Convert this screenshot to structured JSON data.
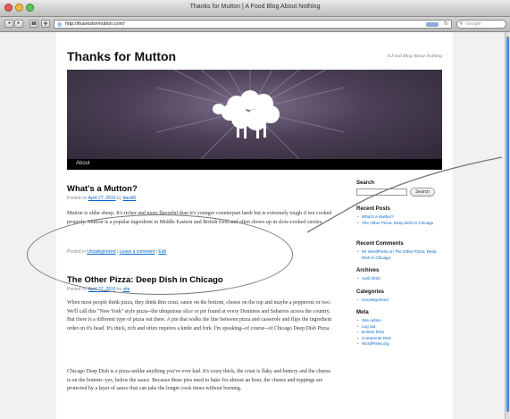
{
  "window": {
    "title": "Thanks for Mutton | A Food Blog About Nothing"
  },
  "toolbar": {
    "back_label": "◂",
    "forward_label": "▸",
    "address": "http://thanksformutton.com/",
    "address_icon": "globe-icon",
    "search_placeholder": "Google"
  },
  "blog": {
    "title": "Thanks for Mutton",
    "description": "A Food Blog About Nothing",
    "nav": [
      "About"
    ]
  },
  "posts": [
    {
      "title": "What's a Mutton?",
      "meta_prefix": "Posted on",
      "date": "April 27, 2010",
      "meta_by": "by",
      "author": "david5",
      "paragraphs": [
        "Mutton is older sheep. It's richer and more flavorful than it's younger counterpart lamb but is extremely tough if not cooked properly. Mutton is a popular ingredient in Middle Eastern and British food and often shows up in slow-cooked curries."
      ],
      "util_prefix": "Posted in",
      "category": "Uncategorized",
      "comment_link": "Leave a comment",
      "edit_link": "Edit"
    },
    {
      "title": "The Other Pizza: Deep Dish in Chicago",
      "meta_prefix": "Posted on",
      "date": "April 27, 2010",
      "meta_by": "by",
      "author": "site",
      "paragraphs": [
        "When most people think pizza, they think thin crust, sauce on the bottom, cheese on the top and maybe a pepperoni or two. We'll call this \"New York\" style pizza--the ubiquitous slice or pie found at every Dominos and Sabarros across the country. But there is a different type of pizza out there. A pie that walks the line between pizza and casserole and flips the ingredient order on it's head. It's thick, rich and often requires a knife and fork. I'm speaking--of course--of Chicago Deep Dish Pizza.",
        "Chicago Deep Dish is a pizza unlike anything you've ever had. It's crazy thick, the crust is flaky and buttery and the cheese is on the bottom--yes, below the sauce. Because these pies need to bake for almost an hour, the cheese and toppings are protected by a layer of sauce that can take the longer cook times without burning."
      ]
    }
  ],
  "sidebar": {
    "search_heading": "Search",
    "search_button": "Search",
    "recent_posts_heading": "Recent Posts",
    "recent_posts": [
      "What's a Mutton?",
      "The Other Pizza: Deep Dish in Chicago"
    ],
    "recent_comments_heading": "Recent Comments",
    "recent_comments": [
      "Mr WordPress on The Other Pizza: Deep Dish in Chicago"
    ],
    "archives_heading": "Archives",
    "archives": [
      "April 2010"
    ],
    "categories_heading": "Categories",
    "categories": [
      "Uncategorized"
    ],
    "meta_heading": "Meta",
    "meta": [
      "Site Admin",
      "Log out",
      "Entries RSS",
      "Comments RSS",
      "WordPress.org"
    ]
  },
  "colors": {
    "link": "#0066cc",
    "header_bg": "#4a3f55",
    "nav_bg": "#000000",
    "callout": "#777777"
  }
}
